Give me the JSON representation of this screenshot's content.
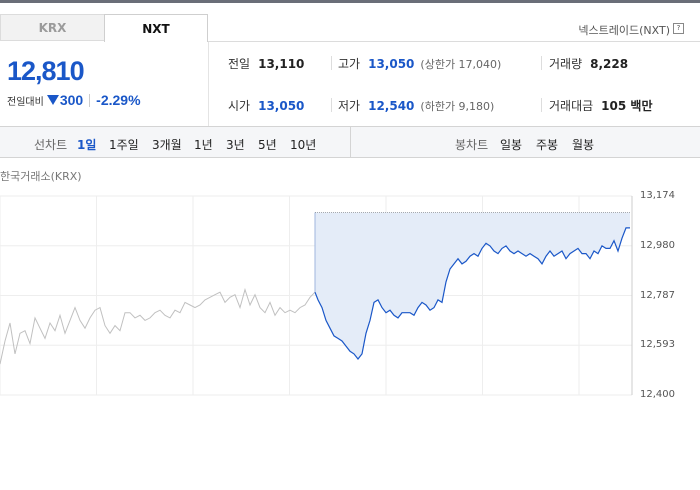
{
  "tabs": {
    "krx": "KRX",
    "nxt": "NXT"
  },
  "nxt_label": "넥스트레이드(NXT)",
  "help_symbol": "?",
  "price": {
    "current": "12,810",
    "change_label": "전일대비",
    "change": "300",
    "change_pct": "-2.29%",
    "direction_icon": "down-triangle-icon"
  },
  "stats": {
    "prev_close": {
      "label": "전일",
      "value": "13,110"
    },
    "high": {
      "label": "고가",
      "value": "13,050",
      "sub": "(상한가 17,040)"
    },
    "volume": {
      "label": "거래량",
      "value": "8,228"
    },
    "open": {
      "label": "시가",
      "value": "13,050"
    },
    "low": {
      "label": "저가",
      "value": "12,540",
      "sub": "(하한가 9,180)"
    },
    "amount": {
      "label": "거래대금",
      "value": "105 백만"
    }
  },
  "period_bar": {
    "line_label": "선차트",
    "line_periods": [
      "1일",
      "1주일",
      "3개월",
      "1년",
      "3년",
      "5년",
      "10년"
    ],
    "active_period": "1일",
    "candle_label": "봉차트",
    "candle_periods": [
      "일봉",
      "주봉",
      "월봉"
    ]
  },
  "chart_title": "한국거래소(KRX)",
  "colors": {
    "accent": "#1a57c8",
    "fill": "#e4ecf8",
    "gray_line": "#c0c0c0"
  },
  "chart_data": {
    "type": "line",
    "title": "한국거래소(KRX)",
    "y_ticks": [
      "13,174",
      "12,980",
      "12,787",
      "12,593",
      "12,400"
    ],
    "ylim": [
      12400,
      13174
    ],
    "reference_line": 13110,
    "series": [
      {
        "style": "gray",
        "x": [
          0,
          5,
          10,
          15,
          20,
          25,
          30,
          35,
          40,
          45,
          50,
          55,
          60,
          65,
          70,
          75,
          80,
          85,
          90,
          95,
          100,
          105,
          110,
          115,
          120,
          125,
          130,
          135,
          140,
          145,
          150,
          155,
          160,
          165,
          170,
          175,
          180,
          185,
          190,
          195,
          200,
          205,
          210,
          215,
          220,
          225,
          230,
          235,
          240,
          245,
          250,
          255,
          260,
          265,
          270,
          275,
          280,
          285,
          290,
          295,
          300,
          305,
          310,
          315
        ],
        "values": [
          12520,
          12610,
          12680,
          12560,
          12640,
          12650,
          12600,
          12700,
          12660,
          12620,
          12680,
          12650,
          12710,
          12640,
          12690,
          12740,
          12690,
          12660,
          12700,
          12730,
          12740,
          12670,
          12640,
          12670,
          12650,
          12720,
          12720,
          12700,
          12710,
          12690,
          12700,
          12720,
          12730,
          12710,
          12700,
          12730,
          12720,
          12760,
          12750,
          12740,
          12750,
          12770,
          12780,
          12790,
          12800,
          12760,
          12780,
          12790,
          12740,
          12810,
          12750,
          12790,
          12740,
          12720,
          12760,
          12710,
          12740,
          12720,
          12730,
          12720,
          12740,
          12750,
          12780,
          12800
        ]
      },
      {
        "style": "blue",
        "x": [
          315,
          318,
          322,
          326,
          330,
          334,
          338,
          342,
          346,
          350,
          354,
          358,
          362,
          366,
          370,
          374,
          378,
          382,
          386,
          390,
          394,
          398,
          402,
          406,
          410,
          414,
          418,
          422,
          426,
          430,
          434,
          438,
          442,
          446,
          450,
          454,
          458,
          462,
          466,
          470,
          474,
          478,
          482,
          486,
          490,
          494,
          498,
          502,
          506,
          510,
          514,
          518,
          522,
          526,
          530,
          534,
          538,
          542,
          546,
          550,
          554,
          558,
          562,
          566,
          570,
          574,
          578,
          582,
          586,
          590,
          594,
          598,
          602,
          606,
          610,
          614,
          618,
          622,
          626,
          630
        ],
        "values": [
          12800,
          12770,
          12740,
          12690,
          12660,
          12630,
          12620,
          12610,
          12590,
          12570,
          12560,
          12540,
          12560,
          12640,
          12690,
          12760,
          12770,
          12740,
          12720,
          12730,
          12710,
          12700,
          12720,
          12720,
          12720,
          12710,
          12740,
          12760,
          12750,
          12730,
          12740,
          12770,
          12760,
          12840,
          12890,
          12910,
          12930,
          12910,
          12920,
          12940,
          12950,
          12940,
          12970,
          12990,
          12980,
          12960,
          12950,
          12970,
          12980,
          12960,
          12950,
          12960,
          12950,
          12940,
          12950,
          12940,
          12930,
          12910,
          12940,
          12960,
          12940,
          12950,
          12960,
          12930,
          12950,
          12960,
          12970,
          12950,
          12950,
          12930,
          12960,
          12950,
          12980,
          12970,
          12970,
          13000,
          12960,
          13010,
          13050,
          13050
        ]
      }
    ]
  }
}
